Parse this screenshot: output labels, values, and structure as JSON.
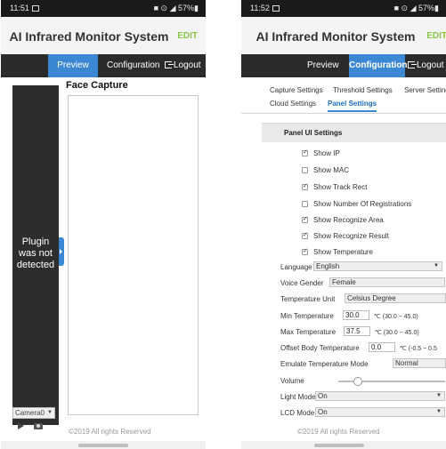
{
  "left": {
    "status": {
      "time": "11:51",
      "icons": "■ ⊙ ◢ 57%▮"
    },
    "app_title": "AI Infrared Monitor System",
    "edit_label": "EDIT",
    "nav": {
      "preview": "Preview",
      "configuration": "Configuration",
      "logout": "Logout"
    },
    "face_capture_title": "Face Capture",
    "plugin_message": [
      "Plugin",
      "was not",
      "detected"
    ],
    "camera_select": "Camera0",
    "footer": "©2019 All rights Reserved"
  },
  "right": {
    "status": {
      "time": "11:52",
      "icons": "■ ⊙ ◢ 57%▮"
    },
    "app_title": "AI Infrared Monitor System",
    "edit_label": "EDIT",
    "nav": {
      "preview": "Preview",
      "configuration": "Configuration",
      "logout": "Logout"
    },
    "sub_tabs": [
      "Capture Settings",
      "Threshold Settings",
      "Server Setting",
      "Cloud Settings",
      "Panel Settings"
    ],
    "panel_title": "Panel UI Settings",
    "checkboxes": [
      {
        "label": "Show IP",
        "checked": true
      },
      {
        "label": "Show MAC",
        "checked": false
      },
      {
        "label": "Show Track Rect",
        "checked": true
      },
      {
        "label": "Show Number Of Registrations",
        "checked": false
      },
      {
        "label": "Show Recognize Area",
        "checked": true
      },
      {
        "label": "Show Recognize Result",
        "checked": true
      },
      {
        "label": "Show Temperature",
        "checked": true
      }
    ],
    "language": {
      "label": "Language",
      "value": "English"
    },
    "voice_gender": {
      "label": "Voice Gender",
      "value": "Female"
    },
    "temperature_unit": {
      "label": "Temperature Unit",
      "value": "Celsius Degree"
    },
    "min_temperature": {
      "label": "Min Temperature",
      "value": "30.0",
      "range": "℃ (30.0 ~ 45.0)"
    },
    "max_temperature": {
      "label": "Max Temperature",
      "value": "37.5",
      "range": "℃ (30.0 ~ 45.0)"
    },
    "offset_temperature": {
      "label": "Offset Body Temperature",
      "value": "0.0",
      "range": "℃ (-0.5 ~ 0.5"
    },
    "emulate_mode": {
      "label": "Emulate Temperature Mode",
      "value": "Normal"
    },
    "volume": {
      "label": "Volume",
      "level": 0.18
    },
    "light_mode": {
      "label": "Light Mode",
      "value": "On"
    },
    "lcd_mode": {
      "label": "LCD Mode",
      "value": "On"
    },
    "footer": "©2019 All rights Reserved"
  }
}
